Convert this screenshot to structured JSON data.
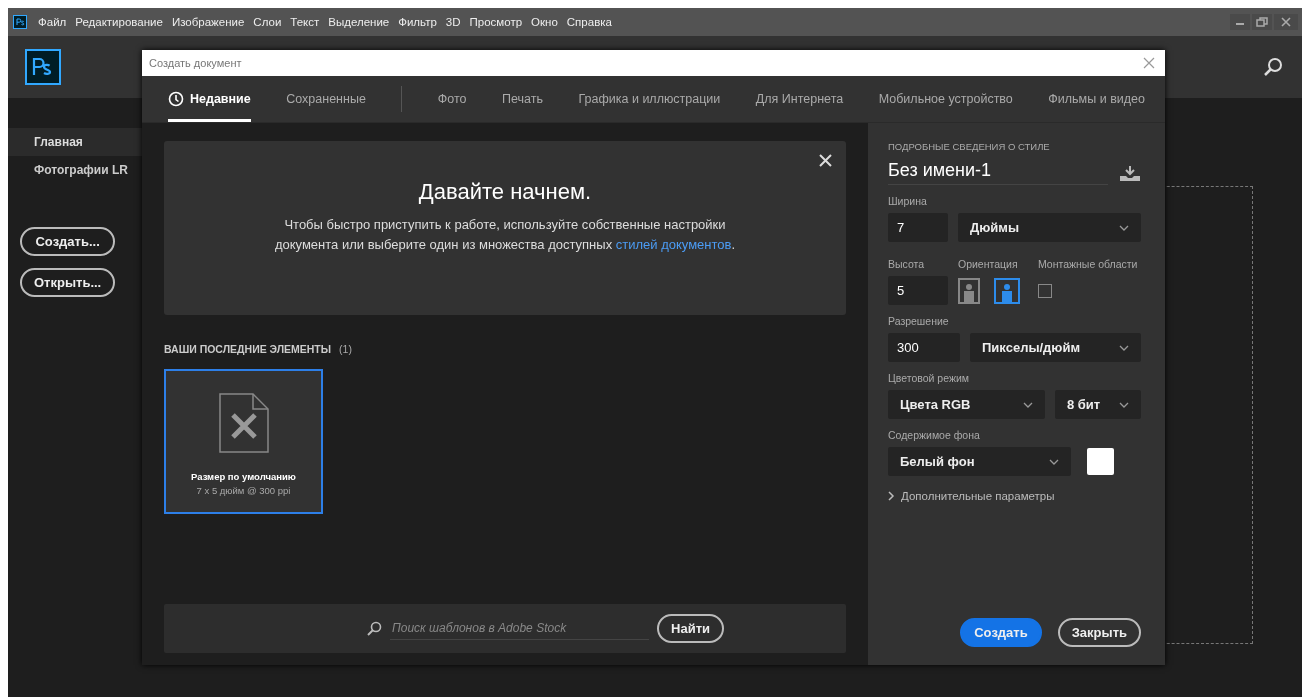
{
  "menu_bar": {
    "items": [
      "Файл",
      "Редактирование",
      "Изображение",
      "Слои",
      "Текст",
      "Выделение",
      "Фильтр",
      "3D",
      "Просмотр",
      "Окно",
      "Справка"
    ]
  },
  "home": {
    "nav": [
      {
        "label": "Главная",
        "selected": true
      },
      {
        "label": "Фотографии LR",
        "selected": false
      }
    ],
    "buttons": [
      "Создать...",
      "Открыть..."
    ]
  },
  "dialog": {
    "title": "Создать документ",
    "tabs": [
      {
        "label": "Недавние",
        "selected": true
      },
      {
        "label": "Сохраненные",
        "selected": false
      },
      {
        "label": "Фото",
        "selected": false
      },
      {
        "label": "Печать",
        "selected": false
      },
      {
        "label": "Графика и иллюстрации",
        "selected": false
      },
      {
        "label": "Для Интернета",
        "selected": false
      },
      {
        "label": "Мобильное устройство",
        "selected": false
      },
      {
        "label": "Фильмы и видео",
        "selected": false
      }
    ],
    "welcome": {
      "heading": "Давайте начнем.",
      "text_before": "Чтобы быстро приступить к работе, используйте собственные настройки документа или выберите один из множества доступных ",
      "link": "стилей документов",
      "text_after": "."
    },
    "recent": {
      "title": "ВАШИ ПОСЛЕДНИЕ ЭЛЕМЕНТЫ",
      "count": "(1)",
      "items": [
        {
          "name": "Размер по умолчанию",
          "size": "7 x 5 дюйм @ 300 ppi",
          "selected": true
        }
      ]
    },
    "stock_search": {
      "placeholder": "Поиск шаблонов в Adobe Stock",
      "button": "Найти"
    },
    "details": {
      "section_title": "ПОДРОБНЫЕ СВЕДЕНИЯ О СТИЛЕ",
      "name": "Без имени-1",
      "width": {
        "label": "Ширина",
        "value": "7",
        "unit": "Дюймы"
      },
      "height": {
        "label": "Высота",
        "value": "5"
      },
      "orientation": {
        "label": "Ориентация",
        "options": [
          {
            "kind": "portrait",
            "selected": false
          },
          {
            "kind": "landscape",
            "selected": true
          }
        ]
      },
      "artboards": {
        "label": "Монтажные области",
        "checked": false
      },
      "resolution": {
        "label": "Разрешение",
        "value": "300",
        "unit": "Пикселы/дюйм"
      },
      "color_mode": {
        "label": "Цветовой режим",
        "mode": "Цвета RGB",
        "depth": "8 бит"
      },
      "background": {
        "label": "Содержимое фона",
        "value": "Белый фон",
        "color": "#ffffff"
      },
      "advanced": {
        "label": "Дополнительные параметры",
        "expanded": false
      }
    },
    "buttons": [
      {
        "label": "Создать",
        "kind": "primary"
      },
      {
        "label": "Закрыть",
        "kind": "secondary"
      }
    ]
  }
}
